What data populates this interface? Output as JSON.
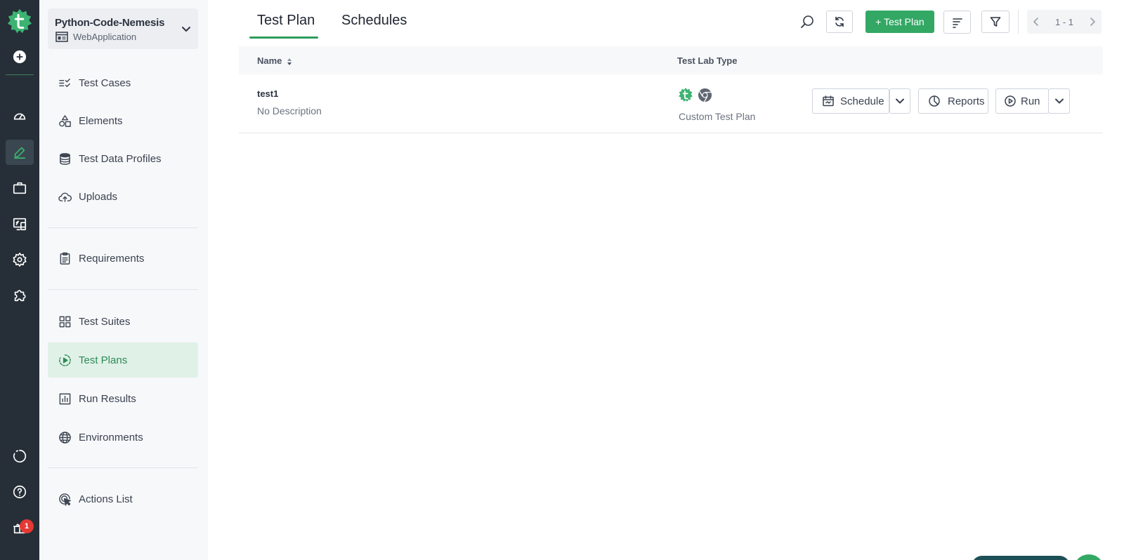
{
  "rail": {
    "badge_count": "1"
  },
  "project": {
    "name": "Python-Code-Nemesis",
    "type": "WebApplication"
  },
  "sidebar": {
    "items": [
      {
        "label": "Test Cases"
      },
      {
        "label": "Elements"
      },
      {
        "label": "Test Data Profiles"
      },
      {
        "label": "Uploads"
      },
      {
        "label": "Requirements"
      },
      {
        "label": "Test Suites"
      },
      {
        "label": "Test Plans"
      },
      {
        "label": "Run Results"
      },
      {
        "label": "Environments"
      },
      {
        "label": "Actions List"
      }
    ],
    "active_item": "Test Plans"
  },
  "tabs": [
    {
      "label": "Test Plan"
    },
    {
      "label": "Schedules"
    }
  ],
  "toolbar": {
    "add_label": "+ Test Plan",
    "pager_label": "1 - 1"
  },
  "table": {
    "columns": [
      "Name",
      "Test Lab Type"
    ],
    "rows": [
      {
        "name": "test1",
        "description": "No Description",
        "lab_type": "Custom Test Plan"
      }
    ],
    "row_actions": {
      "schedule": "Schedule",
      "reports": "Reports",
      "run": "Run"
    }
  },
  "colors": {
    "accent": "#33a865",
    "rail": "#262f38",
    "sidebar_active": "#e0f1e7"
  }
}
